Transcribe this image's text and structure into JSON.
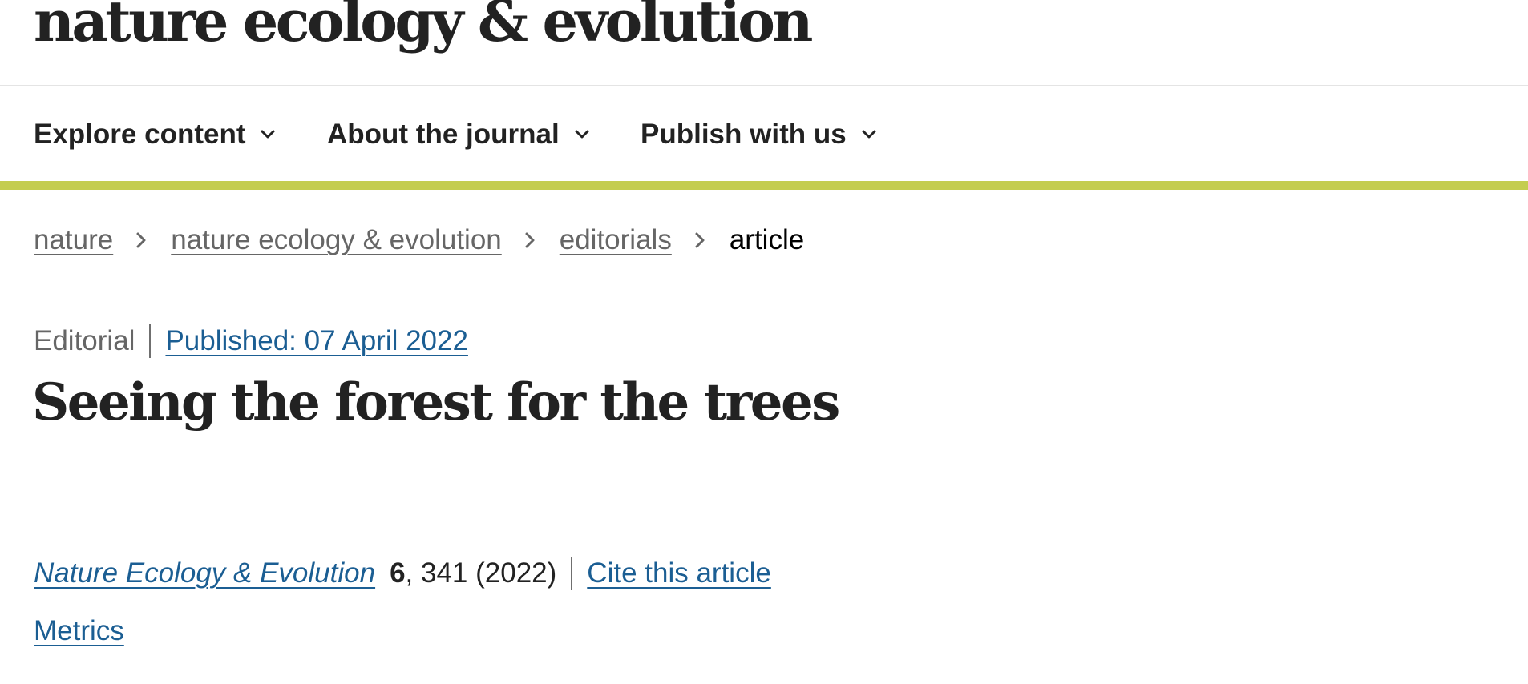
{
  "header": {
    "journal_name": "nature ecology & evolution"
  },
  "nav": {
    "items": [
      {
        "label": "Explore content",
        "icon": "chevron-down-icon"
      },
      {
        "label": "About the journal",
        "icon": "chevron-down-icon"
      },
      {
        "label": "Publish with us",
        "icon": "chevron-down-icon"
      }
    ],
    "accent_color": "#c4cd4f"
  },
  "breadcrumb": {
    "items": [
      "nature",
      "nature ecology & evolution",
      "editorials"
    ],
    "current": "article",
    "separator_icon": "chevron-right-icon"
  },
  "article": {
    "type": "Editorial",
    "published": "Published: 07 April 2022",
    "title": "Seeing the forest for the trees",
    "citation": {
      "journal": "Nature Ecology & Evolution",
      "volume": "6",
      "pages_year": ", 341 (2022)",
      "cite_label": "Cite this article"
    },
    "metrics_label": "Metrics"
  },
  "colors": {
    "link_blue": "#1b5e93",
    "breadcrumb_grey": "#666666",
    "text_dark": "#222222"
  }
}
